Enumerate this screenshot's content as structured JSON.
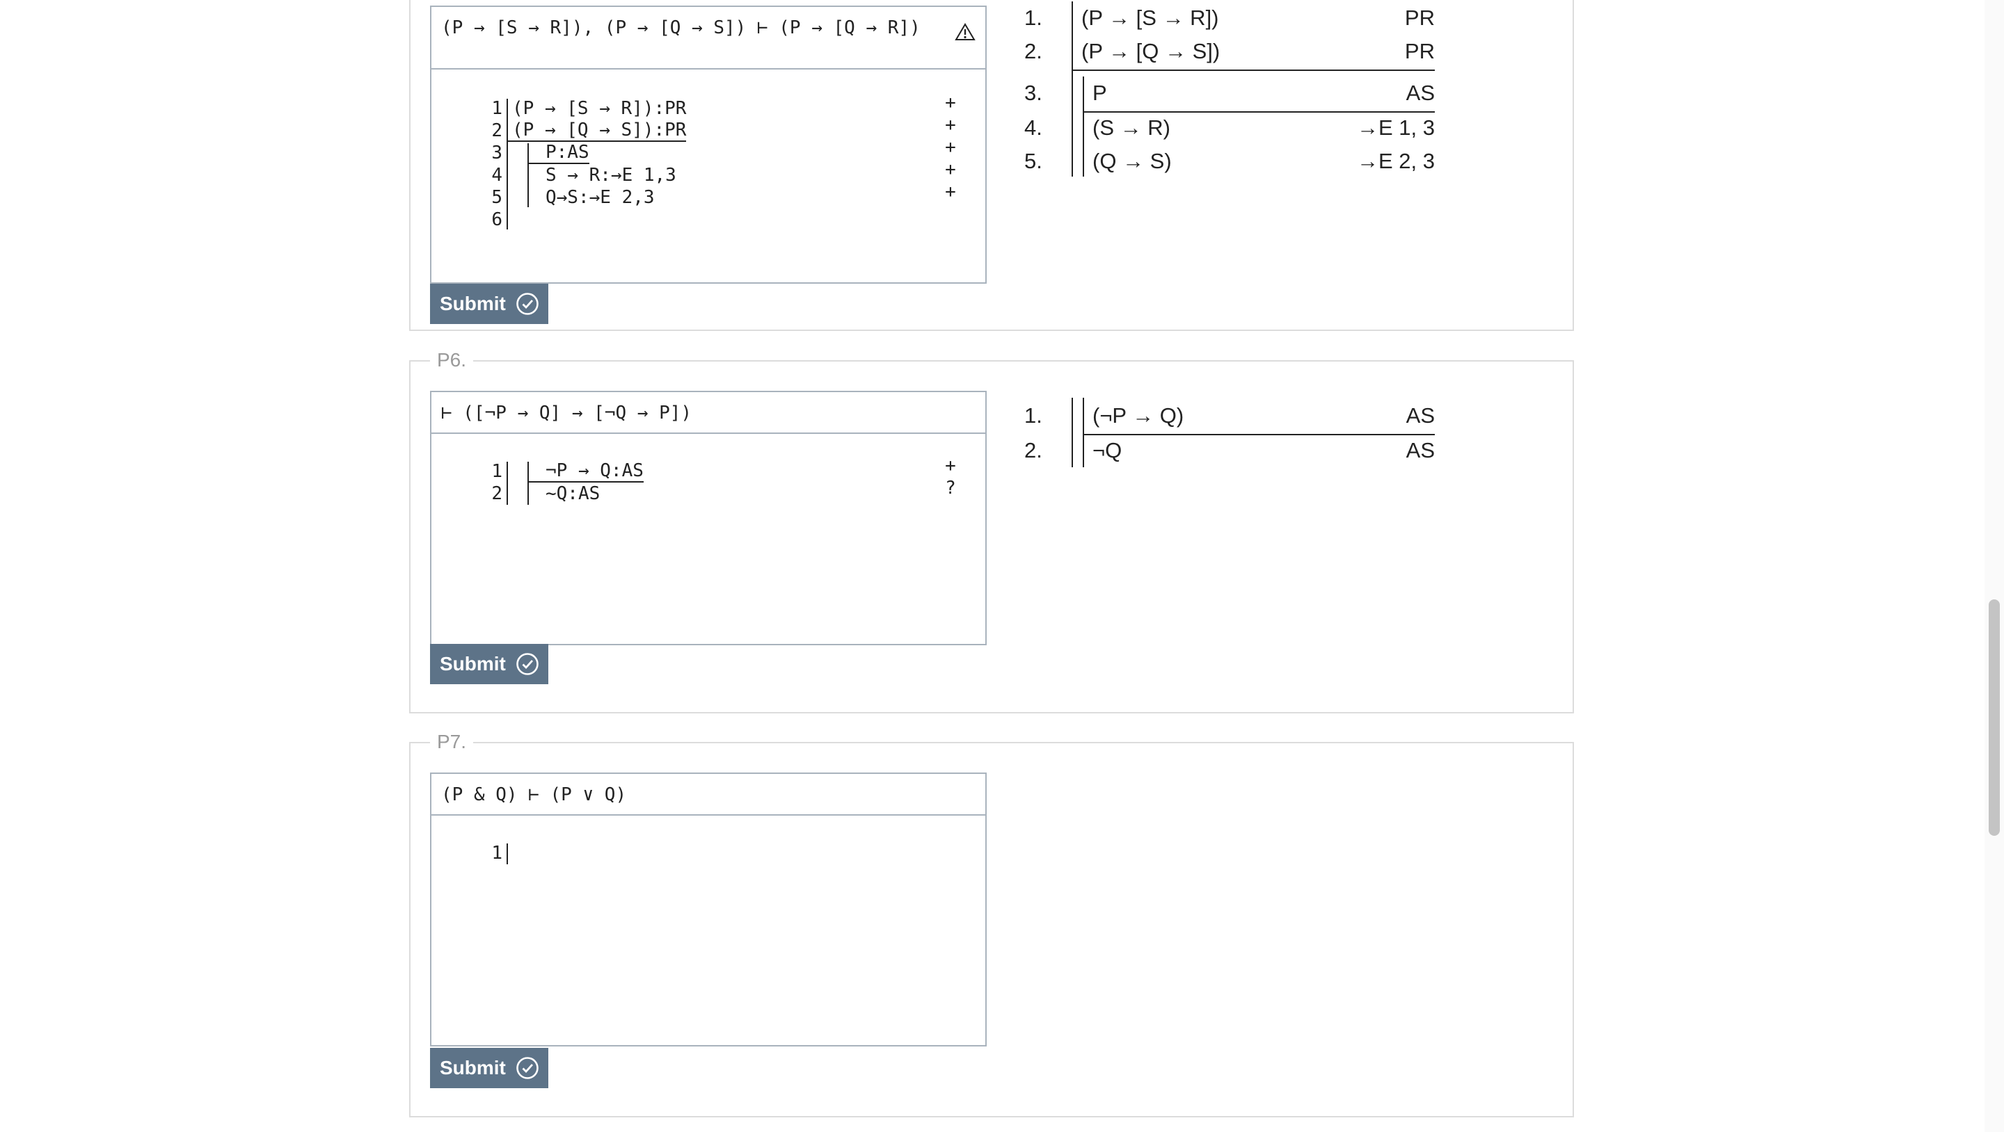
{
  "problems": [
    {
      "legend": "",
      "goal": "(P → [S → R]), (P → [Q → S]) ⊢ (P → [Q → R])",
      "editor_lines": [
        {
          "num": "1",
          "text": "(P → [S → R]):PR",
          "mark": "+"
        },
        {
          "num": "2",
          "text": "(P → [Q → S]):PR",
          "mark": "+"
        },
        {
          "num": "3",
          "text": "P:AS",
          "mark": "+"
        },
        {
          "num": "4",
          "text": "S → R:→E 1,3",
          "mark": "+"
        },
        {
          "num": "5",
          "text": "Q→S:→E 2,3",
          "mark": "+"
        },
        {
          "num": "6",
          "text": "",
          "mark": ""
        }
      ],
      "proof_rows": [
        {
          "num": "1.",
          "formula": "(P → [S → R])",
          "just": "PR"
        },
        {
          "num": "2.",
          "formula": "(P → [Q → S])",
          "just": "PR"
        },
        {
          "num": "3.",
          "formula": "P",
          "just": "AS"
        },
        {
          "num": "4.",
          "formula": "(S → R)",
          "just": "→E 1, 3"
        },
        {
          "num": "5.",
          "formula": "(Q → S)",
          "just": "→E 2, 3"
        }
      ],
      "submit_label": "Submit"
    },
    {
      "legend": "P6.",
      "goal": "⊢ ([¬P → Q] → [¬Q → P])",
      "editor_lines": [
        {
          "num": "1",
          "text": "¬P → Q:AS",
          "mark": "+"
        },
        {
          "num": "2",
          "text": "~Q:AS",
          "mark": "?"
        }
      ],
      "proof_rows": [
        {
          "num": "1.",
          "formula": "(¬P → Q)",
          "just": "AS"
        },
        {
          "num": "2.",
          "formula": "¬Q",
          "just": "AS"
        }
      ],
      "submit_label": "Submit"
    },
    {
      "legend": "P7.",
      "goal": "(P & Q) ⊢ (P ∨ Q)",
      "editor_lines": [
        {
          "num": "1",
          "text": "",
          "mark": ""
        }
      ],
      "proof_rows": [],
      "submit_label": "Submit"
    }
  ],
  "icons": {
    "warning": "warning-icon",
    "check": "check-circle-icon"
  },
  "colors": {
    "submit_bg": "#5d7388",
    "border": "#a9b3bd",
    "legend": "#9a9a9a"
  }
}
